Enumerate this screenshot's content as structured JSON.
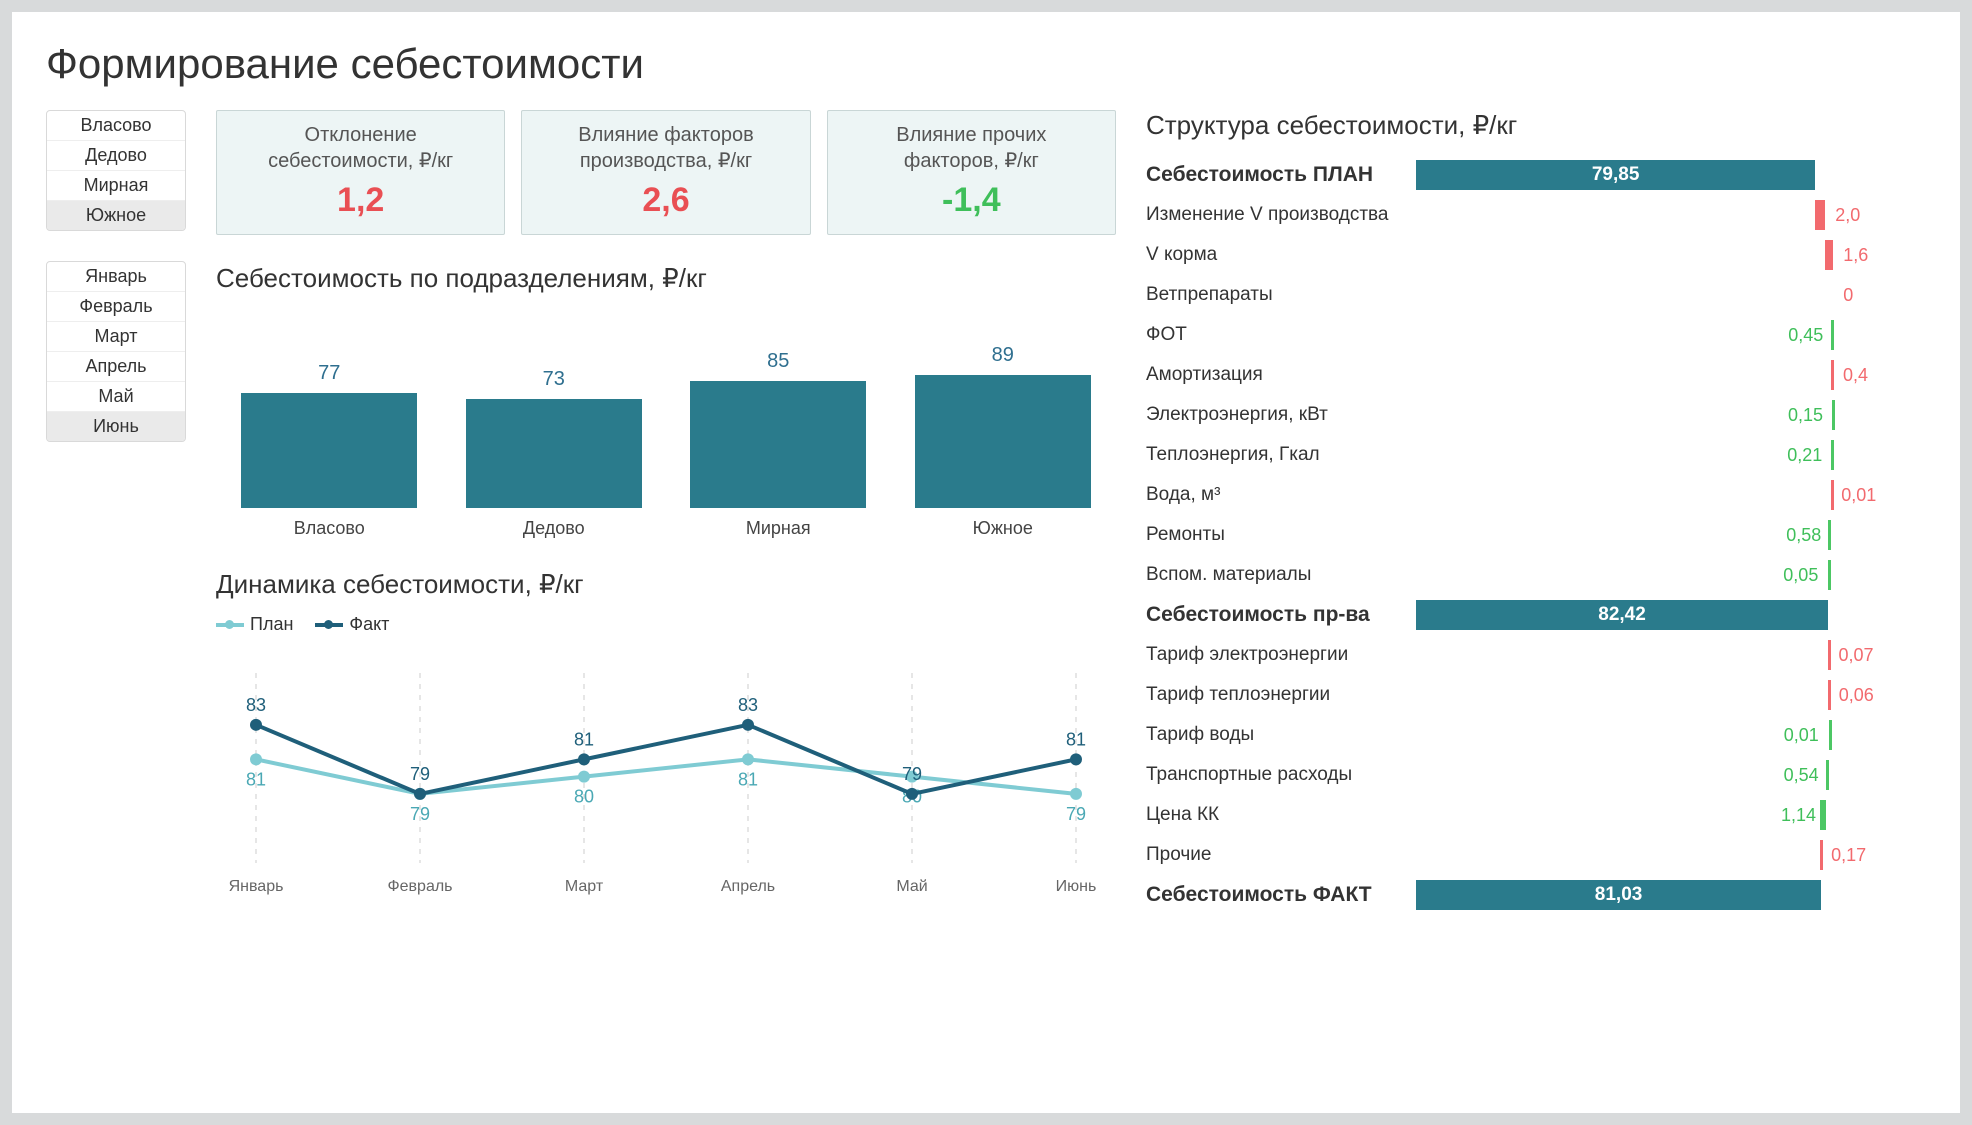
{
  "title": "Формирование себестоимости",
  "slicers": {
    "units": {
      "items": [
        "Власово",
        "Дедово",
        "Мирная",
        "Южное"
      ],
      "selected": "Южное"
    },
    "months": {
      "items": [
        "Январь",
        "Февраль",
        "Март",
        "Апрель",
        "Май",
        "Июнь"
      ],
      "selected": "Июнь"
    }
  },
  "kpis": [
    {
      "label": "Отклонение\nсебестоимости, ₽/кг",
      "value": "1,2",
      "tone": "red"
    },
    {
      "label": "Влияние факторов\nпроизводства, ₽/кг",
      "value": "2,6",
      "tone": "red"
    },
    {
      "label": "Влияние прочих\nфакторов, ₽/кг",
      "value": "-1,4",
      "tone": "green"
    }
  ],
  "sections": {
    "bar": "Себестоимость по подразделениям, ₽/кг",
    "line": "Динамика себестоимости, ₽/кг",
    "waterfall": "Структура себестоимости, ₽/кг"
  },
  "legend": {
    "plan": "План",
    "fact": "Факт"
  },
  "chart_data": [
    {
      "id": "bar",
      "type": "bar",
      "title": "Себестоимость по подразделениям, ₽/кг",
      "categories": [
        "Власово",
        "Дедово",
        "Мирная",
        "Южное"
      ],
      "values": [
        77,
        73,
        85,
        89
      ],
      "ylabel": "₽/кг",
      "ylim": [
        0,
        100
      ]
    },
    {
      "id": "line",
      "type": "line",
      "title": "Динамика себестоимости, ₽/кг",
      "categories": [
        "Январь",
        "Февраль",
        "Март",
        "Апрель",
        "Май",
        "Июнь"
      ],
      "series": [
        {
          "name": "План",
          "values": [
            81,
            79,
            80,
            81,
            80,
            79
          ]
        },
        {
          "name": "Факт",
          "values": [
            83,
            79,
            81,
            83,
            79,
            81
          ]
        }
      ],
      "ylabel": "₽/кг",
      "ylim": [
        75,
        86
      ]
    },
    {
      "id": "waterfall",
      "type": "waterfall",
      "title": "Структура себестоимости, ₽/кг",
      "xlim": [
        0,
        100
      ],
      "items": [
        {
          "label": "Себестоимость ПЛАН",
          "value": 79.85,
          "display": "79,85",
          "kind": "total"
        },
        {
          "label": "Изменение V производства",
          "value": 2.0,
          "display": "2,0",
          "kind": "inc"
        },
        {
          "label": "V корма",
          "value": 1.6,
          "display": "1,6",
          "kind": "inc"
        },
        {
          "label": "Ветпрепараты",
          "value": 0.0,
          "display": "0",
          "kind": "dec"
        },
        {
          "label": "ФОТ",
          "value": -0.45,
          "display": "0,45",
          "kind": "dec"
        },
        {
          "label": "Амортизация",
          "value": 0.4,
          "display": "0,4",
          "kind": "inc"
        },
        {
          "label": "Электроэнергия, кВт",
          "value": -0.15,
          "display": "0,15",
          "kind": "dec"
        },
        {
          "label": "Теплоэнергия, Гкал",
          "value": -0.21,
          "display": "0,21",
          "kind": "dec"
        },
        {
          "label": "Вода, м³",
          "value": 0.01,
          "display": "0,01",
          "kind": "inc"
        },
        {
          "label": "Ремонты",
          "value": -0.58,
          "display": "0,58",
          "kind": "dec"
        },
        {
          "label": "Вспом. материалы",
          "value": -0.05,
          "display": "0,05",
          "kind": "dec"
        },
        {
          "label": "Себестоимость пр-ва",
          "value": 82.42,
          "display": "82,42",
          "kind": "total"
        },
        {
          "label": "Тариф электроэнергии",
          "value": 0.07,
          "display": "0,07",
          "kind": "inc"
        },
        {
          "label": "Тариф теплоэнергии",
          "value": 0.06,
          "display": "0,06",
          "kind": "inc"
        },
        {
          "label": "Тариф воды",
          "value": -0.01,
          "display": "0,01",
          "kind": "dec"
        },
        {
          "label": "Транспортные расходы",
          "value": -0.54,
          "display": "0,54",
          "kind": "dec"
        },
        {
          "label": "Цена КК",
          "value": -1.14,
          "display": "1,14",
          "kind": "dec"
        },
        {
          "label": "Прочие",
          "value": 0.17,
          "display": "0,17",
          "kind": "inc"
        },
        {
          "label": "Себестоимость ФАКТ",
          "value": 81.03,
          "display": "81,03",
          "kind": "total"
        }
      ]
    }
  ]
}
